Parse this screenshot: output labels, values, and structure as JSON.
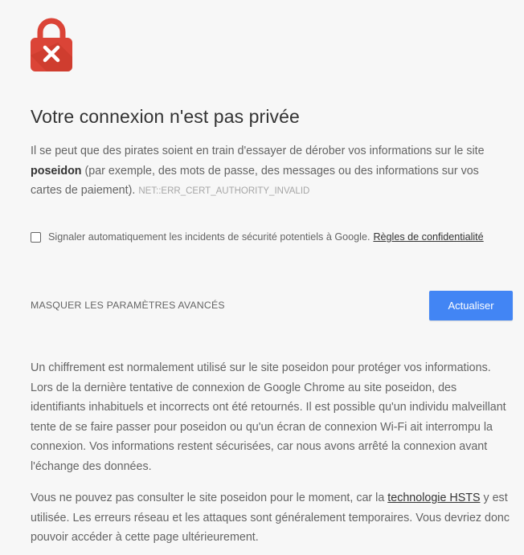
{
  "icon": {
    "name": "lock-error-icon",
    "color": "#db4437"
  },
  "title": "Votre connexion n'est pas privée",
  "intro": {
    "part1": "Il se peut que des pirates soient en train d'essayer de dérober vos informations sur le site ",
    "host": "poseidon",
    "part2": " (par exemple, des mots de passe, des messages ou des informations sur vos cartes de paiement).",
    "error_code": "NET::ERR_CERT_AUTHORITY_INVALID"
  },
  "report": {
    "checked": false,
    "label": "Signaler automatiquement les incidents de sécurité potentiels à Google.",
    "privacy_link": "Règles de confidentialité"
  },
  "advanced_toggle": "MASQUER LES PARAMÈTRES AVANCÉS",
  "reload_button": "Actualiser",
  "accent_color": "#4285f4",
  "details": {
    "paragraph1": "Un chiffrement est normalement utilisé sur le site poseidon pour protéger vos informations. Lors de la dernière tentative de connexion de Google Chrome au site poseidon, des identifiants inhabituels et incorrects ont été retournés. Il est possible qu'un individu malveillant tente de se faire passer pour poseidon ou qu'un écran de connexion Wi-Fi ait interrompu la connexion. Vos informations restent sécurisées, car nous avons arrêté la connexion avant l'échange des données.",
    "paragraph2_part1": "Vous ne pouvez pas consulter le site poseidon pour le moment, car la ",
    "hsts_link": "technologie HSTS",
    "paragraph2_part2": " y est utilisée. Les erreurs réseau et les attaques sont généralement temporaires. Vous devriez donc pouvoir accéder à cette page ultérieurement."
  }
}
